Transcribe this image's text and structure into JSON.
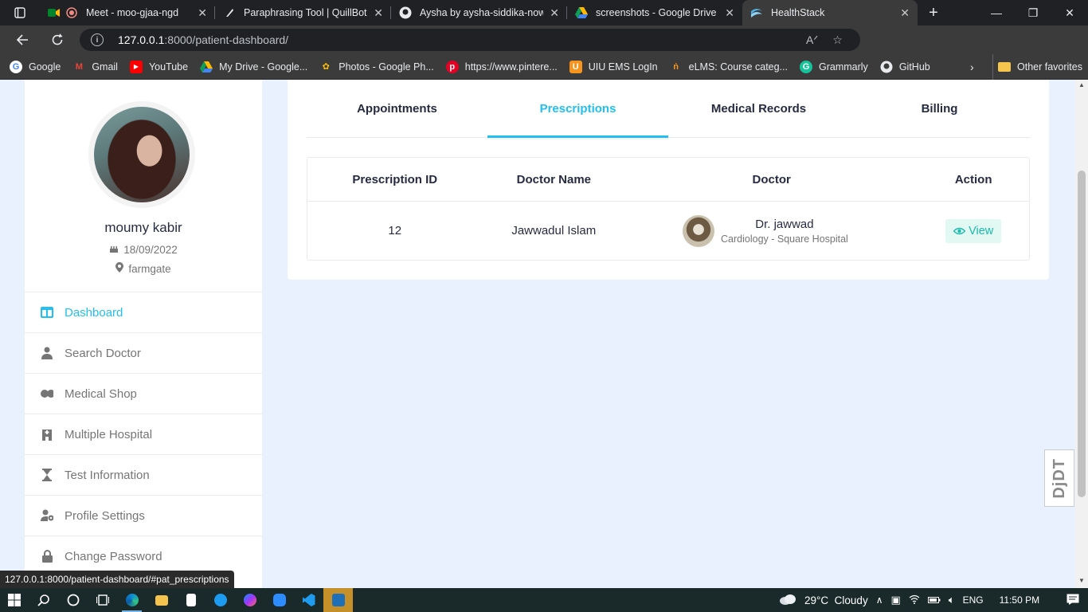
{
  "browser": {
    "tabs": [
      {
        "title": "Meet - moo-gjaa-ngd",
        "icon": "meet-icon",
        "close": "✕"
      },
      {
        "title": "Paraphrasing Tool | QuillBot AI",
        "icon": "quillbot-icon",
        "close": "✕"
      },
      {
        "title": "Aysha by aysha-siddika-nowshin",
        "icon": "github-icon",
        "close": "✕"
      },
      {
        "title": "screenshots - Google Drive",
        "icon": "drive-icon",
        "close": "✕"
      },
      {
        "title": "HealthStack",
        "icon": "healthstack-icon",
        "close": "✕"
      }
    ],
    "url_host": "127.0.0.1",
    "url_path": ":8000/patient-dashboard/",
    "bookmarks": [
      {
        "label": "Google",
        "icon": "google-icon"
      },
      {
        "label": "Gmail",
        "icon": "gmail-icon"
      },
      {
        "label": "YouTube",
        "icon": "youtube-icon"
      },
      {
        "label": "My Drive - Google...",
        "icon": "drive-icon"
      },
      {
        "label": "Photos - Google Ph...",
        "icon": "photos-icon"
      },
      {
        "label": "https://www.pintere...",
        "icon": "pinterest-icon"
      },
      {
        "label": "UIU EMS LogIn",
        "icon": "uiu-icon"
      },
      {
        "label": "eLMS: Course categ...",
        "icon": "elms-icon"
      },
      {
        "label": "Grammarly",
        "icon": "grammarly-icon"
      },
      {
        "label": "GitHub",
        "icon": "github-icon"
      }
    ],
    "other_favorites": "Other favorites",
    "status_url": "127.0.0.1:8000/patient-dashboard/#pat_prescriptions"
  },
  "profile": {
    "name": "moumy kabir",
    "dob": "18/09/2022",
    "location": "farmgate"
  },
  "sidebar": {
    "items": [
      {
        "label": "Dashboard",
        "icon": "dashboard-icon",
        "active": true
      },
      {
        "label": "Search Doctor",
        "icon": "doctor-icon",
        "active": false
      },
      {
        "label": "Medical Shop",
        "icon": "pills-icon",
        "active": false
      },
      {
        "label": "Multiple Hospital",
        "icon": "hospital-icon",
        "active": false
      },
      {
        "label": "Test Information",
        "icon": "hourglass-icon",
        "active": false
      },
      {
        "label": "Profile Settings",
        "icon": "user-cog-icon",
        "active": false
      },
      {
        "label": "Change Password",
        "icon": "lock-icon",
        "active": false
      }
    ]
  },
  "main": {
    "tabs": [
      {
        "label": "Appointments",
        "active": false
      },
      {
        "label": "Prescriptions",
        "active": true
      },
      {
        "label": "Medical Records",
        "active": false
      },
      {
        "label": "Billing",
        "active": false
      }
    ],
    "table": {
      "headers": [
        "Prescription ID",
        "Doctor Name",
        "Doctor",
        "Action"
      ],
      "rows": [
        {
          "prescription_id": "12",
          "doctor_name": "Jawwadul Islam",
          "doctor_display": "Dr. jawwad",
          "doctor_specialty": "Cardiology - Square Hospital",
          "action": "View"
        }
      ]
    }
  },
  "djdt_label": "DjDT",
  "taskbar": {
    "weather": "29°C  Cloudy",
    "lang": "ENG",
    "time": "11:50 PM"
  },
  "colors": {
    "accent": "#20c0f3",
    "view_button_bg": "#e1f8f3",
    "view_button_text": "#1db9aa",
    "page_bg": "#e8f1fd"
  }
}
